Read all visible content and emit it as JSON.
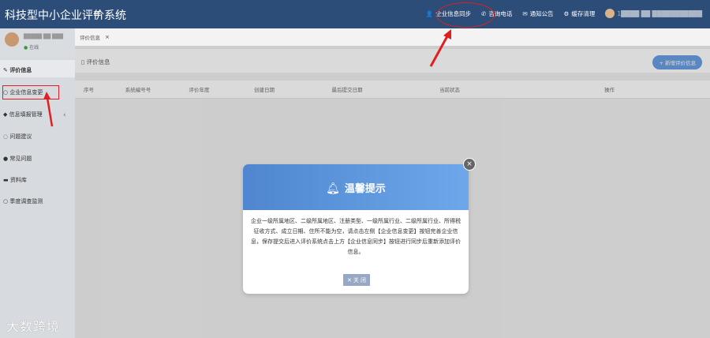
{
  "header": {
    "title": "科技型中小企业评价系统",
    "menu_toggle": "≡",
    "nav": [
      {
        "label": "企业信息同步",
        "icon": "user-icon"
      },
      {
        "label": "咨询电话",
        "icon": "phone-icon"
      },
      {
        "label": "通知公告",
        "icon": "mail-icon"
      },
      {
        "label": "缓存清理",
        "icon": "gear-icon"
      }
    ],
    "user_text": "1████ ██ ███████████"
  },
  "sidebar": {
    "user_name": "█████ ██ ███",
    "status": "在线",
    "items": [
      {
        "label": "评价信息",
        "icon": "edit-icon"
      },
      {
        "label": "企业信息变更",
        "icon": "circle-icon"
      },
      {
        "label": "信息填报管理",
        "icon": "tag-icon"
      },
      {
        "label": "问题建议",
        "icon": "chat-icon"
      },
      {
        "label": "常见问题",
        "icon": "question-icon"
      },
      {
        "label": "资料库",
        "icon": "folder-icon"
      },
      {
        "label": "季度调查监测",
        "icon": "circle-icon"
      }
    ],
    "watermark": "大数跨境"
  },
  "tabs": [
    {
      "label": "评价信息",
      "close": "×"
    }
  ],
  "panel": {
    "title": "评价信息",
    "add_button": "+ 新增评价信息"
  },
  "table": {
    "columns": [
      "序号",
      "系统编号号",
      "评价年度",
      "创建日期",
      "最后提交日期",
      "当前状态",
      "操作"
    ]
  },
  "modal": {
    "title": "温馨提示",
    "body": "企业一级所属地区、二级所属地区、注册类型、一级所属行业、二级所属行业、所得税征收方式、成立日期、住所不能为空，请点击左侧【企业信息变更】按钮完善企业信息，保存提交后进入评价系统点击上方【企业信息同步】按钮进行同步后重新添加评价信息。",
    "close_button": "关 闭",
    "close_x": "×"
  },
  "colors": {
    "header_bg": "#2d4d79",
    "sidebar_bg": "#d7dadf",
    "accent": "#3b7fd9",
    "highlight_red": "#e02020"
  }
}
